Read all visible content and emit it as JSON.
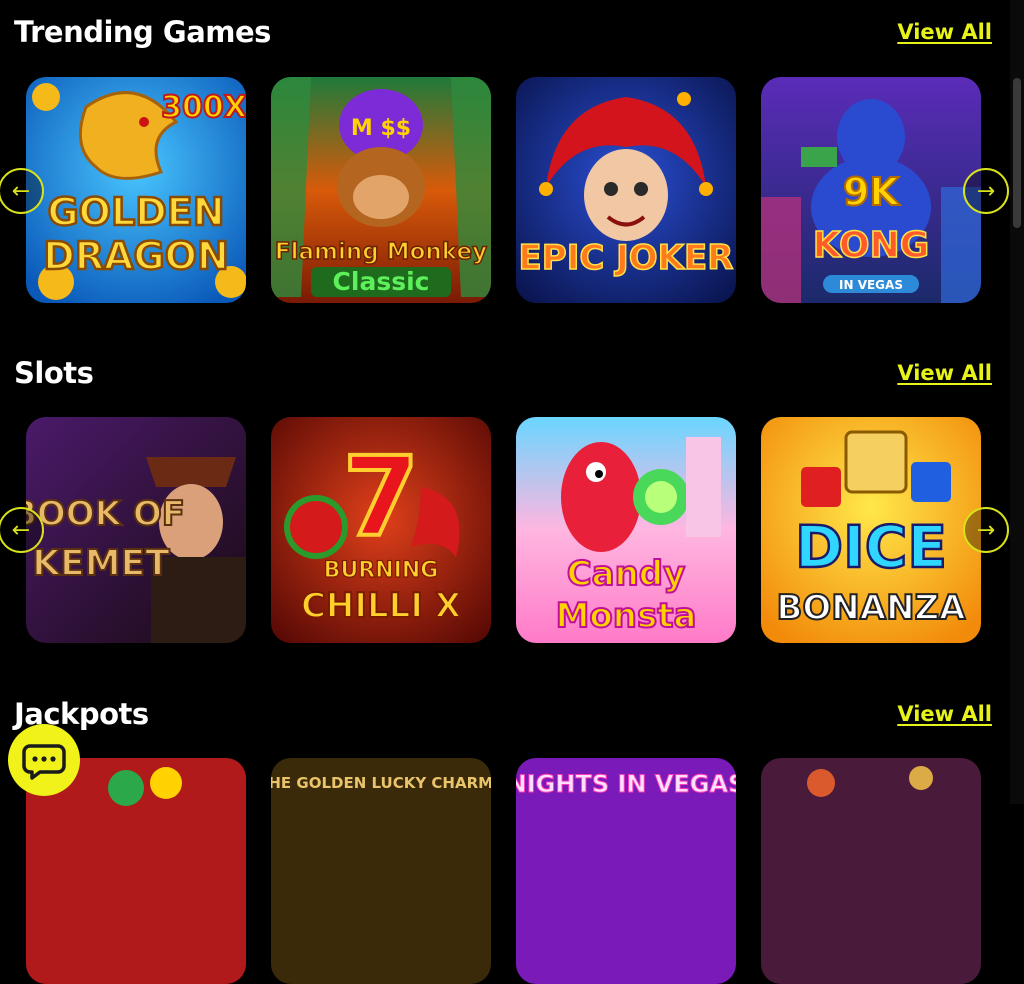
{
  "sections": [
    {
      "title": "Trending Games",
      "view_all": "View All",
      "games": [
        {
          "name": "GOLDEN DRAGON",
          "badge": "300X",
          "line1": "GOLDEN",
          "line2": "DRAGON"
        },
        {
          "name": "Flaming Monkey Classic",
          "badge": "M $$",
          "line1": "Flaming Monkey",
          "line2": "Classic"
        },
        {
          "name": "EPIC JOKER",
          "line1": "EPIC JOKER"
        },
        {
          "name": "9K KONG IN VEGAS",
          "badge": "9K",
          "line1": "KONG",
          "line2": "IN VEGAS"
        }
      ]
    },
    {
      "title": "Slots",
      "view_all": "View All",
      "games": [
        {
          "name": "BOOK OF KEMET",
          "line1": "BOOK OF",
          "line2": "KEMET"
        },
        {
          "name": "BURNING CHILLI X",
          "badge": "7",
          "line1": "BURNING",
          "line2": "CHILLI X"
        },
        {
          "name": "Candy Monsta",
          "line1": "Candy",
          "line2": "Monsta"
        },
        {
          "name": "DICE BONANZA",
          "line1": "DICE",
          "line2": "BONANZA"
        }
      ]
    },
    {
      "title": "Jackpots",
      "view_all": "View All",
      "games": [
        {
          "name": ""
        },
        {
          "name": "THE GOLDEN LUCKY CHARMS",
          "line1": "THE GOLDEN LUCKY CHARMS"
        },
        {
          "name": "NIGHTS IN VEGAS",
          "line1": "NIGHTS IN VEGAS"
        },
        {
          "name": ""
        }
      ]
    }
  ],
  "arrows": {
    "prev": "←",
    "next": "→"
  },
  "colors": {
    "accent": "#e6f21a",
    "background": "#000000",
    "chat": "#f0f219"
  },
  "icons": {
    "chat": "chat-bubble-icon",
    "prev": "arrow-left-icon",
    "next": "arrow-right-icon"
  }
}
